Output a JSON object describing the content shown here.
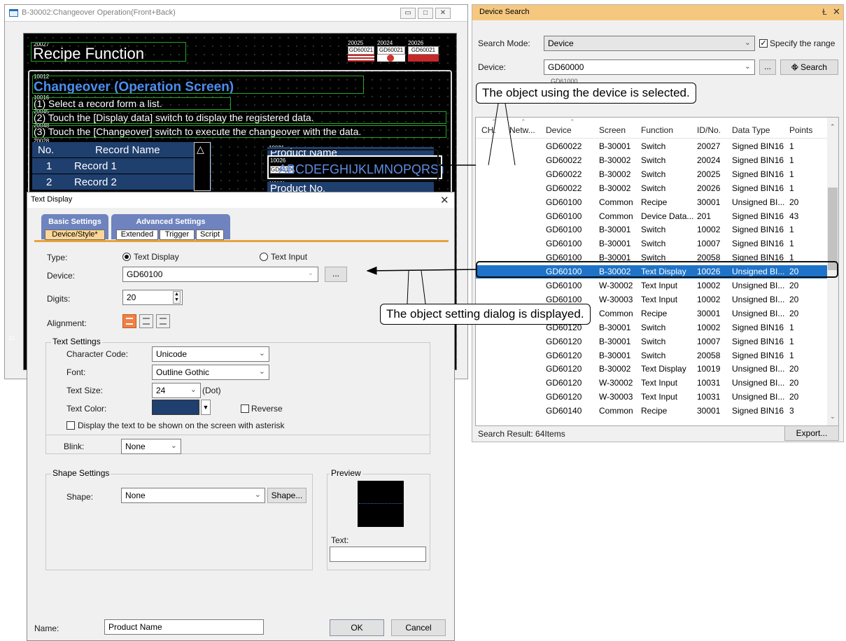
{
  "screen_window": {
    "title": "B-30002:Changeover Operation(Front+Back)",
    "heading": "Recipe Function",
    "heading_id": "20027",
    "top_buttons": [
      {
        "id": "20025",
        "device": "GD60021"
      },
      {
        "id": "20024",
        "device": "GD60021"
      },
      {
        "id": "20026",
        "device": "GD60021"
      }
    ],
    "panel_id": "10012",
    "panel_title": "Changeover (Operation Screen)",
    "line1_id": "10016",
    "line1": "(1) Select a record form a list.",
    "line2_id": "20045",
    "line2": "(2) Touch the [Display data] switch to display the registered data.",
    "line3_id": "20048",
    "line3": "(3) Touch the [Changeover] switch to execute the changeover with the data.",
    "table_id": "20028",
    "col_no": "No.",
    "col_name": "Record Name",
    "rows": [
      {
        "no": "1",
        "name": "Record 1"
      },
      {
        "no": "2",
        "name": "Record 2"
      }
    ],
    "product_name_id": "10021",
    "product_name_label": "Product Name",
    "text_obj_id": "10026",
    "text_obj_device": "GD60100",
    "text_obj_text": "ABCDEFGHIJKLMNOPQRST",
    "product_no_id": "10028",
    "product_no_label": "Product No.",
    "left_id": "10"
  },
  "dialog": {
    "title": "Text Display",
    "tab_basic": "Basic Settings",
    "tab_advanced": "Advanced Settings",
    "subtab_device": "Device/Style*",
    "subtab_extended": "Extended",
    "subtab_trigger": "Trigger",
    "subtab_script": "Script",
    "type_label": "Type:",
    "type_opt1": "Text Display",
    "type_opt2": "Text Input",
    "device_label": "Device:",
    "device_value": "GD60100",
    "device_btn": "...",
    "digits_label": "Digits:",
    "digits_value": "20",
    "alignment_label": "Alignment:",
    "text_settings": "Text Settings",
    "charcode_label": "Character Code:",
    "charcode_value": "Unicode",
    "font_label": "Font:",
    "font_value": "Outline Gothic",
    "textsize_label": "Text Size:",
    "textsize_value": "24",
    "textsize_unit": "(Dot)",
    "textcolor_label": "Text Color:",
    "text_color": "#1f3f6e",
    "reverse_label": "Reverse",
    "asterisk_label": "Display the text to be shown on the screen with asterisk",
    "blink_label": "Blink:",
    "blink_value": "None",
    "shape_settings": "Shape Settings",
    "shape_label": "Shape:",
    "shape_value": "None",
    "shape_btn": "Shape...",
    "preview_label": "Preview",
    "text_label": "Text:",
    "text_value": "",
    "name_label": "Name:",
    "name_value": "Product Name",
    "ok": "OK",
    "cancel": "Cancel"
  },
  "device_search": {
    "title": "Device Search",
    "pin": "Ɫ",
    "close": "✕",
    "search_mode_label": "Search Mode:",
    "search_mode_value": "Device",
    "specify_range": "Specify the range",
    "device_label": "Device:",
    "device_value": "GD60000",
    "more_btn": "...",
    "search_btn": "Search",
    "ghost_value": "GD61000",
    "headers": [
      "CH.",
      "Netw...",
      "Device",
      "Screen",
      "Function",
      "ID/No.",
      "Data Type",
      "Points"
    ],
    "rows": [
      [
        "GD60022",
        "B-30001",
        "Switch",
        "20027",
        "Signed BIN16",
        "1"
      ],
      [
        "GD60022",
        "B-30002",
        "Switch",
        "20024",
        "Signed BIN16",
        "1"
      ],
      [
        "GD60022",
        "B-30002",
        "Switch",
        "20025",
        "Signed BIN16",
        "1"
      ],
      [
        "GD60022",
        "B-30002",
        "Switch",
        "20026",
        "Signed BIN16",
        "1"
      ],
      [
        "GD60100",
        "Common",
        "Recipe",
        "30001",
        "Unsigned BI...",
        "20"
      ],
      [
        "GD60100",
        "Common",
        "Device Data...",
        "201",
        "Signed BIN16",
        "43"
      ],
      [
        "GD60100",
        "B-30001",
        "Switch",
        "10002",
        "Signed BIN16",
        "1"
      ],
      [
        "GD60100",
        "B-30001",
        "Switch",
        "10007",
        "Signed BIN16",
        "1"
      ],
      [
        "GD60100",
        "B-30001",
        "Switch",
        "20058",
        "Signed BIN16",
        "1"
      ],
      [
        "GD60100",
        "B-30002",
        "Text Display",
        "10026",
        "Unsigned BI...",
        "20"
      ],
      [
        "GD60100",
        "W-30002",
        "Text Input",
        "10002",
        "Unsigned BI...",
        "20"
      ],
      [
        "GD60100",
        "W-30003",
        "Text Input",
        "10002",
        "Unsigned BI...",
        "20"
      ],
      [
        "GD60120",
        "Common",
        "Recipe",
        "30001",
        "Unsigned BI...",
        "20"
      ],
      [
        "GD60120",
        "B-30001",
        "Switch",
        "10002",
        "Signed BIN16",
        "1"
      ],
      [
        "GD60120",
        "B-30001",
        "Switch",
        "10007",
        "Signed BIN16",
        "1"
      ],
      [
        "GD60120",
        "B-30001",
        "Switch",
        "20058",
        "Signed BIN16",
        "1"
      ],
      [
        "GD60120",
        "B-30002",
        "Text Display",
        "10019",
        "Unsigned BI...",
        "20"
      ],
      [
        "GD60120",
        "W-30002",
        "Text Input",
        "10031",
        "Unsigned BI...",
        "20"
      ],
      [
        "GD60120",
        "W-30003",
        "Text Input",
        "10031",
        "Unsigned BI...",
        "20"
      ],
      [
        "GD60140",
        "Common",
        "Recipe",
        "30001",
        "Signed BIN16",
        "3"
      ]
    ],
    "selected_index": 9,
    "result": "Search Result: 64Items",
    "export": "Export..."
  },
  "callouts": {
    "selected": "The object using the device is selected.",
    "dialog": "The object setting dialog is displayed."
  }
}
